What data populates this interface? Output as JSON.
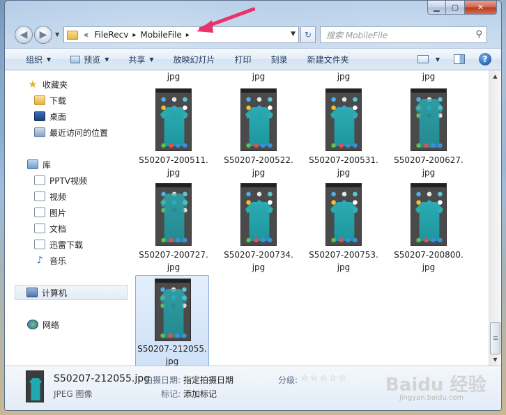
{
  "address": {
    "breadcrumbs": [
      "FileRecv",
      "MobileFile"
    ],
    "overflow_label": "«",
    "separator": "▸"
  },
  "search": {
    "placeholder": "搜索 MobileFile"
  },
  "toolbar": {
    "organize": "组织",
    "preview": "预览",
    "share": "共享",
    "slideshow": "放映幻灯片",
    "print": "打印",
    "burn": "刻录",
    "new_folder": "新建文件夹"
  },
  "sidebar": {
    "favorites": "收藏夹",
    "downloads": "下载",
    "desktop": "桌面",
    "recent": "最近访问的位置",
    "libraries": "库",
    "pptv": "PPTV视频",
    "videos": "视频",
    "pictures": "图片",
    "documents": "文档",
    "thunder": "迅雷下载",
    "music": "音乐",
    "computer": "计算机",
    "network": "网络"
  },
  "files": {
    "partial_row_ext": [
      "jpg",
      "jpg",
      "jpg",
      "jpg"
    ],
    "tiles": [
      {
        "name": "S50207-200511.",
        "ext": "jpg"
      },
      {
        "name": "S50207-200522.",
        "ext": "jpg"
      },
      {
        "name": "S50207-200531.",
        "ext": "jpg"
      },
      {
        "name": "S50207-200627.",
        "ext": "jpg"
      },
      {
        "name": "S50207-200727.",
        "ext": "jpg"
      },
      {
        "name": "S50207-200734.",
        "ext": "jpg"
      },
      {
        "name": "S50207-200753.",
        "ext": "jpg"
      },
      {
        "name": "S50207-200800.",
        "ext": "jpg"
      },
      {
        "name": "S50207-212055.",
        "ext": "jpg"
      }
    ]
  },
  "details": {
    "filename": "S50207-212055.jpg",
    "filetype": "JPEG 图像",
    "date_taken_label": "拍摄日期:",
    "date_taken_value": "指定拍摄日期",
    "tags_label": "标记:",
    "tags_value": "添加标记",
    "rating_label": "分级:",
    "rating_stars": "☆☆☆☆☆",
    "rating_value": 0
  },
  "watermark": {
    "text": "Baidu 经验",
    "sub": "jingyan.baidu.com"
  },
  "colors": {
    "accent_selected": "#cfe1f7",
    "toolbar_text": "#1e395b",
    "annotation_arrow": "#e8336b"
  }
}
